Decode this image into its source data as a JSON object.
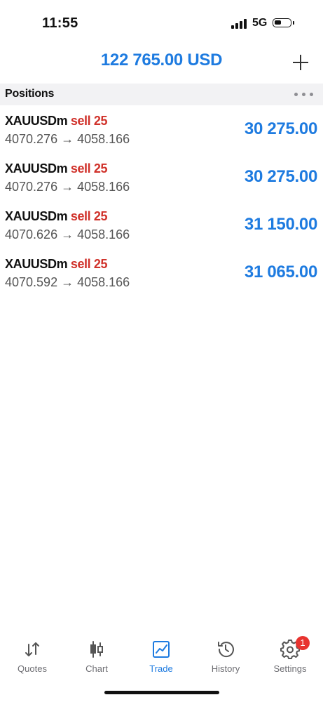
{
  "status": {
    "time": "11:55",
    "network": "5G"
  },
  "header": {
    "balance": "122 765.00 USD",
    "add_icon": "plus-icon"
  },
  "section": {
    "title": "Positions",
    "more_icon": "ellipsis-icon"
  },
  "positions": [
    {
      "symbol": "XAUUSDm",
      "direction": "sell 25",
      "prices": "4070.276 → 4058.166",
      "profit": "30 275.00"
    },
    {
      "symbol": "XAUUSDm",
      "direction": "sell 25",
      "prices": "4070.276 → 4058.166",
      "profit": "30 275.00"
    },
    {
      "symbol": "XAUUSDm",
      "direction": "sell 25",
      "prices": "4070.626 → 4058.166",
      "profit": "31 150.00"
    },
    {
      "symbol": "XAUUSDm",
      "direction": "sell 25",
      "prices": "4070.592 → 4058.166",
      "profit": "31 065.00"
    }
  ],
  "tabs": [
    {
      "label": "Quotes",
      "icon": "quotes-icon"
    },
    {
      "label": "Chart",
      "icon": "chart-icon"
    },
    {
      "label": "Trade",
      "icon": "trade-icon",
      "active": true
    },
    {
      "label": "History",
      "icon": "history-icon"
    },
    {
      "label": "Settings",
      "icon": "gear-icon",
      "badge": "1"
    }
  ],
  "colors": {
    "accent": "#1e7be0",
    "sell": "#d0312a",
    "badge": "#e8332f"
  }
}
